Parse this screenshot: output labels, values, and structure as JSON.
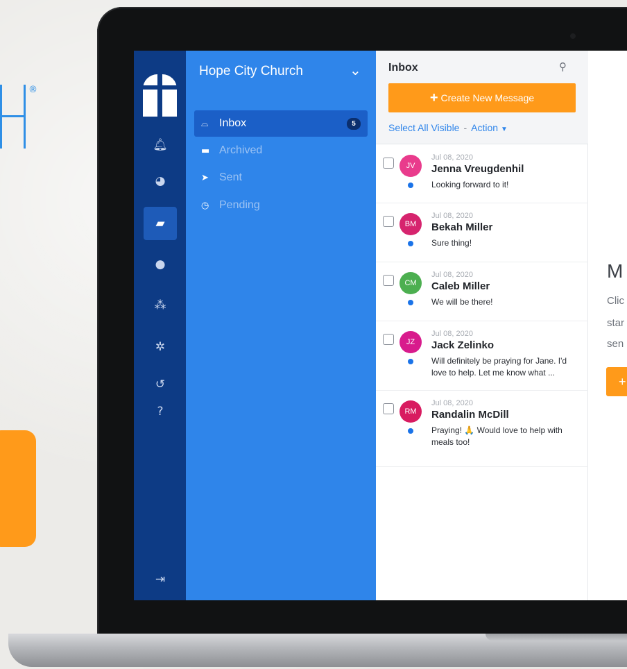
{
  "brand": {
    "glyph": "H",
    "registered": "®"
  },
  "app": {
    "church_name": "Hope City Church"
  },
  "rail": {
    "icons": [
      "bell-icon",
      "dashboard-icon",
      "messages-icon",
      "person-icon",
      "group-icon",
      "gear-icon",
      "undo-icon",
      "help-icon",
      "logout-icon"
    ],
    "active": "messages-icon"
  },
  "folders": [
    {
      "label": "Inbox",
      "icon": "inbox-icon",
      "count": "5",
      "active": true
    },
    {
      "label": "Archived",
      "icon": "archive-icon"
    },
    {
      "label": "Sent",
      "icon": "paper-plane-icon"
    },
    {
      "label": "Pending",
      "icon": "clock-icon"
    }
  ],
  "list": {
    "title": "Inbox",
    "create_label": "Create New Message",
    "select_all": "Select All Visible",
    "separator": "-",
    "action": "Action"
  },
  "messages": [
    {
      "initials": "JV",
      "color": "#e93b8c",
      "date": "Jul 08, 2020",
      "name": "Jenna Vreugdenhil",
      "preview": "Looking forward to it!"
    },
    {
      "initials": "BM",
      "color": "#d6246e",
      "date": "Jul 08, 2020",
      "name": "Bekah Miller",
      "preview": "Sure thing!"
    },
    {
      "initials": "CM",
      "color": "#4caf50",
      "date": "Jul 08, 2020",
      "name": "Caleb Miller",
      "preview": "We will be there!"
    },
    {
      "initials": "JZ",
      "color": "#d81b8c",
      "date": "Jul 08, 2020",
      "name": "Jack Zelinko",
      "preview": "Will definitely be praying for Jane. I'd love to help. Let me know what ..."
    },
    {
      "initials": "RM",
      "color": "#d81b60",
      "date": "Jul 08, 2020",
      "name": "Randalin McDill",
      "preview": "Praying! 🙏 Would love to help with meals too!"
    }
  ],
  "detail": {
    "title": "M",
    "lines": [
      "Clic",
      "star",
      "sen"
    ],
    "button": "+"
  },
  "colors": {
    "rail": "#0d3b85",
    "folders": "#2f85ea",
    "accent": "#ff9a1a"
  }
}
